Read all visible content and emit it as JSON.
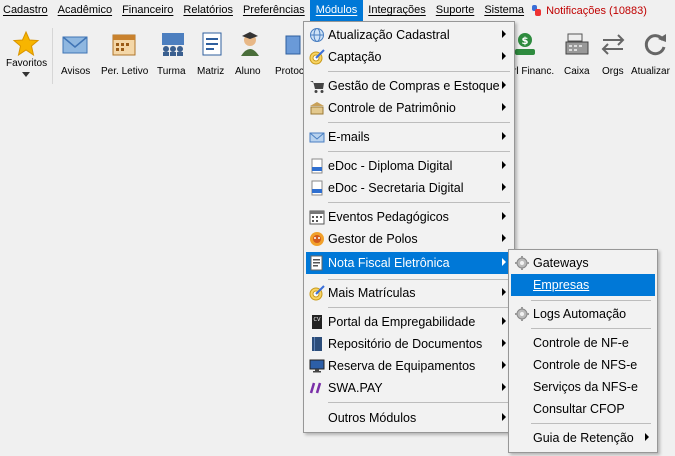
{
  "menubar": {
    "items": [
      "Cadastro",
      "Acadêmico",
      "Financeiro",
      "Relatórios",
      "Preferências",
      "Módulos",
      "Integrações",
      "Suporte",
      "Sistema"
    ],
    "notification": "Notificações (10883)"
  },
  "toolbar": {
    "items": [
      "Favoritos",
      "Avisos",
      "Per. Letivo",
      "Turma",
      "Matriz",
      "Aluno",
      "Protoc",
      "rl Financ.",
      "Caixa",
      "Orgs",
      "Atualizar"
    ]
  },
  "modulos_menu": {
    "items": [
      {
        "label": "Atualização Cadastral",
        "icon": "globe-icon",
        "submenu": true
      },
      {
        "label": "Captação",
        "icon": "target-icon",
        "submenu": true
      },
      {
        "label": "Gestão de Compras e Estoque",
        "icon": "cart-icon",
        "submenu": true
      },
      {
        "label": "Controle de Patrimônio",
        "icon": "building-icon",
        "submenu": true
      },
      {
        "label": "E-mails",
        "icon": "envelope-icon",
        "submenu": true
      },
      {
        "label": "eDoc - Diploma Digital",
        "icon": "edoc-icon",
        "submenu": true
      },
      {
        "label": "eDoc - Secretaria Digital",
        "icon": "edoc-icon",
        "submenu": true
      },
      {
        "label": "Eventos Pedagógicos",
        "icon": "calendar-icon",
        "submenu": true
      },
      {
        "label": "Gestor de Polos",
        "icon": "globe-flag-icon",
        "submenu": true
      },
      {
        "label": "Nota Fiscal Eletrônica",
        "icon": "invoice-icon",
        "submenu": true
      },
      {
        "label": "Mais Matrículas",
        "icon": "target-icon",
        "submenu": true
      },
      {
        "label": "Portal da Empregabilidade",
        "icon": "cv-icon",
        "submenu": true
      },
      {
        "label": "Repositório de Documentos",
        "icon": "book-icon",
        "submenu": true
      },
      {
        "label": "Reserva de Equipamentos",
        "icon": "monitor-icon",
        "submenu": true
      },
      {
        "label": "SWA.PAY",
        "icon": "swapay-icon",
        "submenu": true
      },
      {
        "label": "Outros Módulos",
        "icon": "",
        "submenu": true
      }
    ]
  },
  "nfe_menu": {
    "items": [
      {
        "label": "Gateways",
        "icon": "gear-icon"
      },
      {
        "label": "Empresas",
        "icon": ""
      },
      {
        "label": "Logs Automação",
        "icon": "gear-icon"
      },
      {
        "label": "Controle de NF-e",
        "icon": ""
      },
      {
        "label": "Controle de NFS-e",
        "icon": ""
      },
      {
        "label": "Serviços da NFS-e",
        "icon": ""
      },
      {
        "label": "Consultar CFOP",
        "icon": ""
      },
      {
        "label": "Guia de Retenção",
        "icon": "",
        "submenu": true
      }
    ]
  },
  "colors": {
    "highlight": "#0078d7",
    "notification": "#c00000",
    "menu_bg": "#f2f2f2"
  }
}
